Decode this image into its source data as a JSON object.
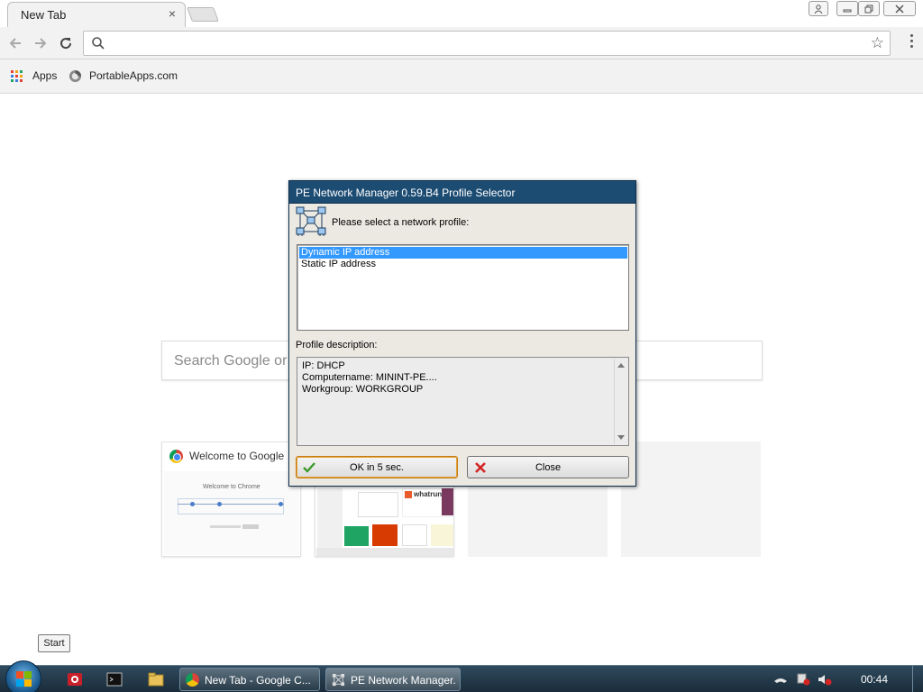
{
  "browser": {
    "tab": {
      "title": "New Tab",
      "close": "×"
    },
    "window_buttons": {
      "user_icon": "user-icon",
      "minimize": "minimize-icon",
      "restore": "restore-icon",
      "close": "close-icon"
    },
    "omnibox": {
      "value": "",
      "placeholder": ""
    },
    "bookmarks": [
      {
        "label": "Apps",
        "icon": "apps-grid-icon"
      },
      {
        "label": "PortableApps.com",
        "icon": "portableapps-icon"
      }
    ],
    "ntp": {
      "search_placeholder": "Search Google or",
      "tiles": [
        {
          "title": "Welcome to Google",
          "thumb_caption": "Welcome to Chrome"
        },
        {
          "title": "",
          "thumb_caption": "whatruns"
        },
        {
          "title": "",
          "thumb_caption": ""
        },
        {
          "title": "",
          "thumb_caption": ""
        }
      ]
    }
  },
  "start_tooltip": "Start",
  "dialog": {
    "title": "PE Network Manager 0.59.B4 Profile Selector",
    "prompt": "Please select a network profile:",
    "profiles": [
      "Dynamic IP address",
      "Static IP address"
    ],
    "selected_index": 0,
    "description_label": "Profile description:",
    "description_lines": [
      "IP: DHCP",
      "Computername: MININT-PE....",
      "Workgroup: WORKGROUP"
    ],
    "ok_button": "OK in 5 sec.",
    "close_button": "Close"
  },
  "taskbar": {
    "tasks": [
      {
        "label": "New Tab - Google C...",
        "icon": "chrome-icon"
      },
      {
        "label": "PE Network Manager...",
        "icon": "network-icon"
      }
    ],
    "clock": "00:44"
  }
}
